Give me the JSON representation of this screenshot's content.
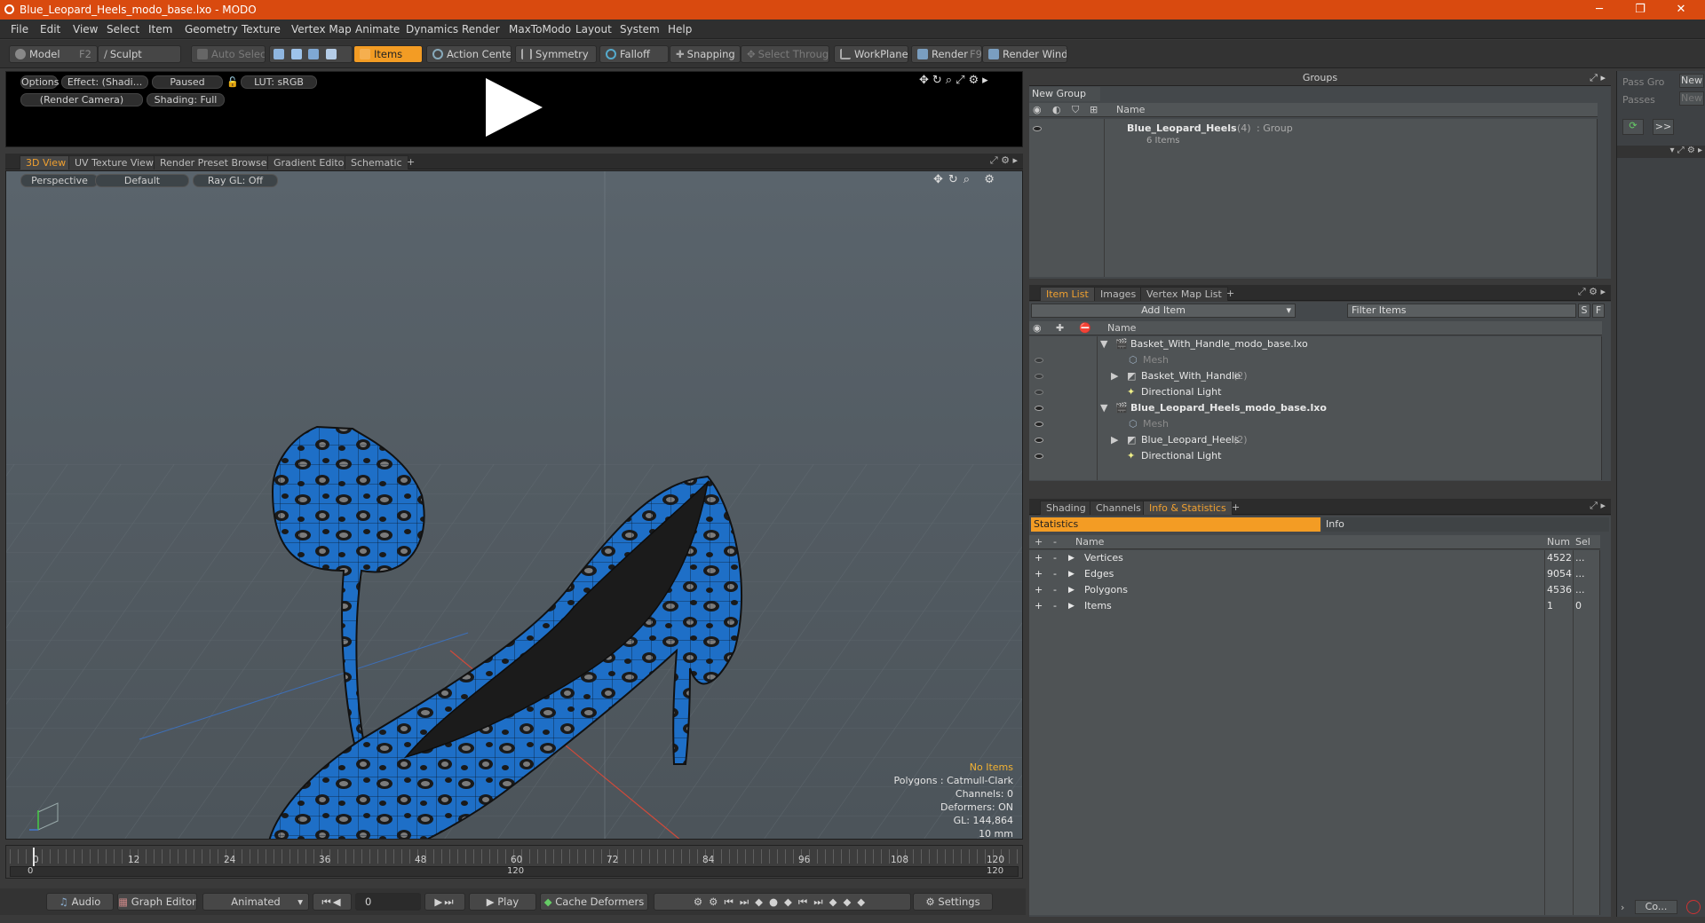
{
  "window": {
    "title": "Blue_Leopard_Heels_modo_base.lxo - MODO",
    "minimize": "─",
    "maximize": "❐",
    "close": "✕"
  },
  "menu": [
    "File",
    "Edit",
    "View",
    "Select",
    "Item",
    "Geometry",
    "Texture",
    "Vertex Map",
    "Animate",
    "Dynamics",
    "Render",
    "MaxToModo",
    "Layout",
    "System",
    "Help"
  ],
  "toolbar": {
    "model": "Model",
    "model_key": "F2",
    "sculpt": "Sculpt",
    "auto_select": "Auto Select",
    "items": "Items",
    "action_center": "Action Center",
    "symmetry": "Symmetry",
    "falloff": "Falloff",
    "snapping": "Snapping",
    "select_through": "Select Through",
    "workplane": "WorkPlane",
    "render": "Render",
    "render_key": "F9",
    "render_window": "Render Window"
  },
  "preview": {
    "options": "Options",
    "effect": "Effect: (Shadi...",
    "paused": "Paused",
    "lut": "LUT: sRGB",
    "camera": "(Render Camera)",
    "shading": "Shading: Full"
  },
  "viewtabs": [
    "3D View",
    "UV Texture View",
    "Render Preset Browser",
    "Gradient Editor",
    "Schematic",
    "+"
  ],
  "viewport": {
    "perspective": "Perspective",
    "default": "Default",
    "raygl": "Ray GL: Off",
    "hud": {
      "no_items": "No Items",
      "polygons": "Polygons : Catmull-Clark",
      "channels": "Channels: 0",
      "deformers": "Deformers: ON",
      "gl": "GL: 144,864",
      "scale": "10 mm"
    }
  },
  "timeline": {
    "ticks": [
      "0",
      "12",
      "24",
      "36",
      "48",
      "60",
      "72",
      "84",
      "96",
      "108",
      "120"
    ],
    "sub_left": "0",
    "sub_mid": "120",
    "sub_right": "120"
  },
  "bottombar": {
    "audio": "Audio",
    "graph_editor": "Graph Editor",
    "animated": "Animated",
    "frame": "0",
    "play": "Play",
    "cache_deformers": "Cache Deformers",
    "settings": "Settings"
  },
  "groups": {
    "title": "Groups",
    "new_group": "New Group",
    "col_name": "Name",
    "item_name": "Blue_Leopard_Heels",
    "item_count": "(4)",
    "item_type": ": Group",
    "item_sub": "6 Items"
  },
  "itemlist": {
    "tabs": [
      "Item List",
      "Images",
      "Vertex Map List",
      "+"
    ],
    "add_item": "Add Item",
    "filter": "Filter Items",
    "s": "S",
    "f": "F",
    "col_name": "Name",
    "rows": [
      {
        "label": "Basket_With_Handle_modo_base.lxo",
        "count": ""
      },
      {
        "label": "Mesh",
        "count": ""
      },
      {
        "label": "Basket_With_Handle",
        "count": "(2)"
      },
      {
        "label": "Directional Light",
        "count": ""
      },
      {
        "label": "Blue_Leopard_Heels_modo_base.lxo",
        "count": ""
      },
      {
        "label": "Mesh",
        "count": ""
      },
      {
        "label": "Blue_Leopard_Heels",
        "count": "(2)"
      },
      {
        "label": "Directional Light",
        "count": ""
      }
    ]
  },
  "stats": {
    "tabs": [
      "Shading",
      "Channels",
      "Info & Statistics",
      "+"
    ],
    "statistics": "Statistics",
    "info": "Info",
    "col_name": "Name",
    "col_num": "Num",
    "col_sel": "Sel",
    "rows": [
      {
        "name": "Vertices",
        "num": "4522",
        "sel": "..."
      },
      {
        "name": "Edges",
        "num": "9054",
        "sel": "..."
      },
      {
        "name": "Polygons",
        "num": "4536",
        "sel": "..."
      },
      {
        "name": "Items",
        "num": "1",
        "sel": "0"
      }
    ]
  },
  "pass": {
    "pass_groups": "Pass Gro",
    "passes": "Passes",
    "new1": "New",
    "new2": "New",
    "expand": ">>",
    "co": "Co..."
  }
}
